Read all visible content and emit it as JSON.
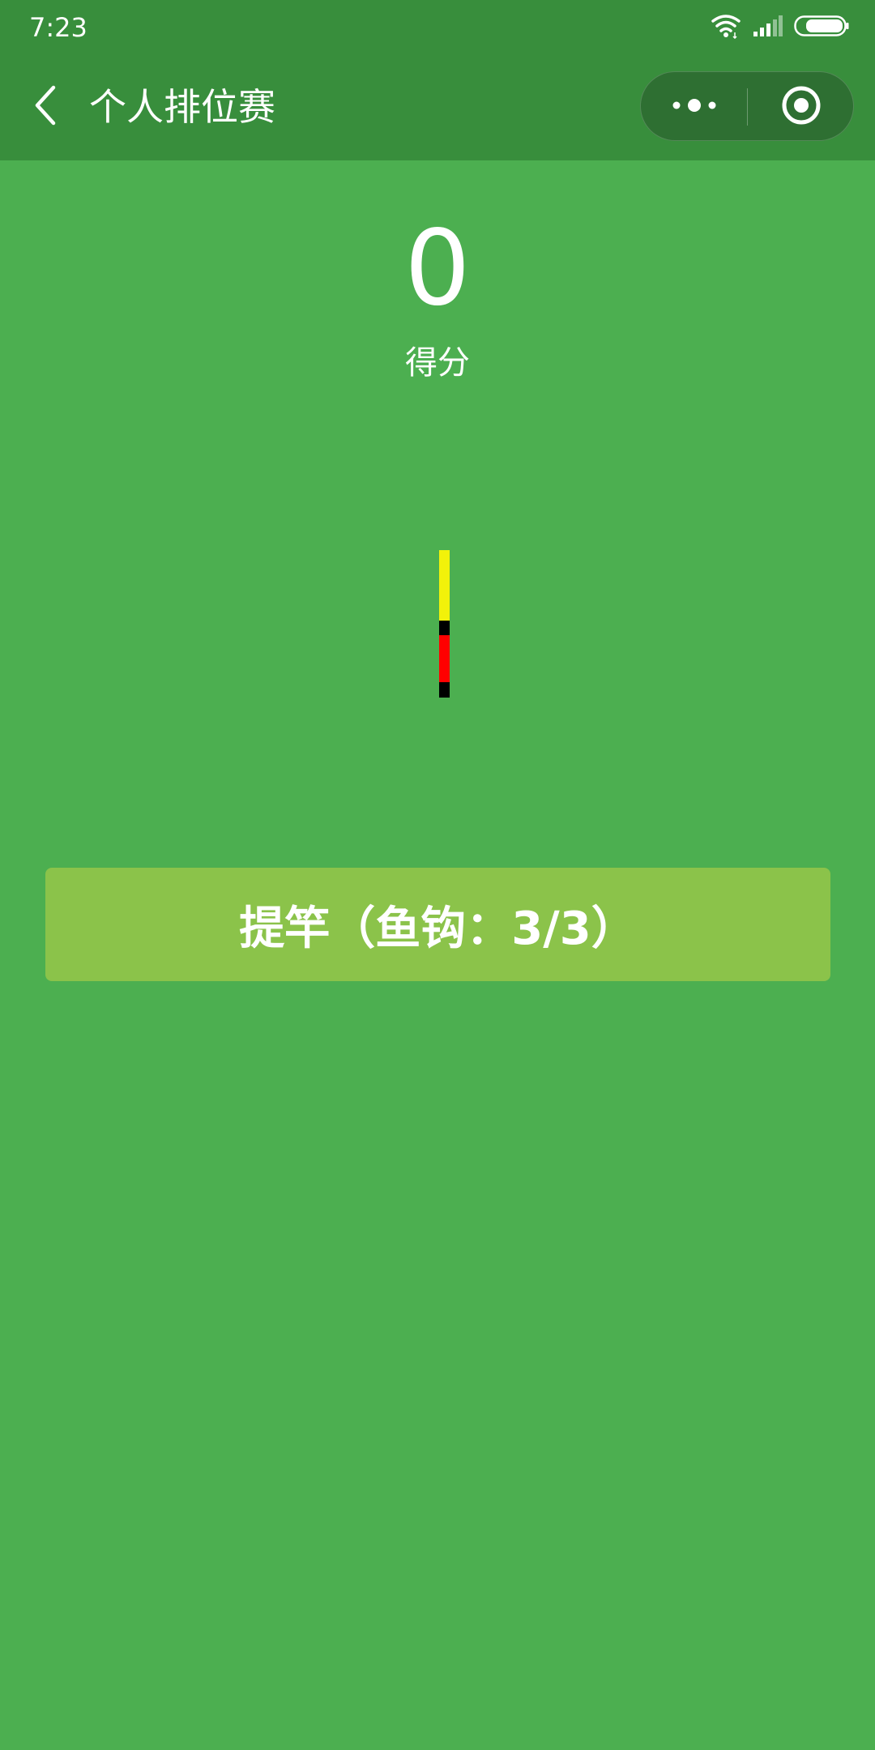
{
  "status_bar": {
    "time": "7:23",
    "icons": [
      "wifi-icon",
      "signal-icon",
      "battery-icon"
    ]
  },
  "nav": {
    "title": "个人排位赛",
    "back_icon": "chevron-left-icon",
    "more_icon": "more-dots-icon",
    "close_icon": "target-circle-icon"
  },
  "score": {
    "value": "0",
    "label": "得分"
  },
  "tension_meter": {
    "segments": [
      {
        "color": "#f2f20a",
        "name": "meter-segment-yellow"
      },
      {
        "color": "#000000",
        "name": "meter-segment-black"
      },
      {
        "color": "#ff0000",
        "name": "meter-segment-red"
      },
      {
        "color": "#000000",
        "name": "meter-segment-black"
      }
    ]
  },
  "pull_button": {
    "label": "提竿（鱼钩：3/3）"
  },
  "colors": {
    "background": "#4caf50",
    "header": "#388e3c",
    "capsule": "#2e6f32",
    "button": "#8bc34a",
    "text": "#ffffff"
  }
}
